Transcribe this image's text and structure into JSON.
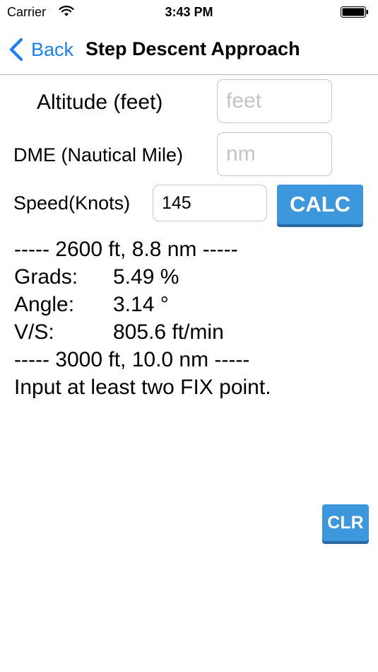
{
  "status_bar": {
    "carrier": "Carrier",
    "time": "3:43 PM",
    "wifi_icon": "wifi-icon",
    "battery_icon": "battery-icon"
  },
  "nav": {
    "back_label": "Back",
    "title": "Step Descent Approach",
    "accent_color": "#1a80f5"
  },
  "form": {
    "altitude": {
      "label": "Altitude (feet)",
      "value": "",
      "placeholder": "feet"
    },
    "dme": {
      "label": "DME (Nautical Mile)",
      "value": "",
      "placeholder": "nm"
    },
    "speed": {
      "label": "Speed(Knots)",
      "value": "145",
      "placeholder": ""
    },
    "calc_label": "CALC"
  },
  "results": {
    "header1": "----- 2600 ft, 8.8 nm -----",
    "grads": {
      "label": "Grads:",
      "value": "5.49 %"
    },
    "angle": {
      "label": "Angle:",
      "value": "3.14 °"
    },
    "vs": {
      "label": "V/S:",
      "value": "805.6 ft/min"
    },
    "header2": "----- 3000 ft, 10.0 nm -----",
    "message": "Input at least two FIX point."
  },
  "clear_label": "CLR",
  "button_color": "#3d97dc"
}
